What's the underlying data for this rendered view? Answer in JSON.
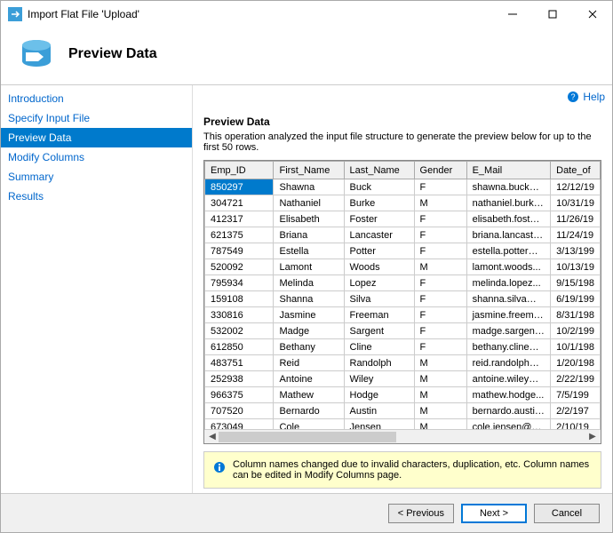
{
  "window": {
    "title": "Import Flat File 'Upload'"
  },
  "header": {
    "title": "Preview Data"
  },
  "help": {
    "label": "Help"
  },
  "sidebar": {
    "items": [
      {
        "label": "Introduction"
      },
      {
        "label": "Specify Input File"
      },
      {
        "label": "Preview Data"
      },
      {
        "label": "Modify Columns"
      },
      {
        "label": "Summary"
      },
      {
        "label": "Results"
      }
    ]
  },
  "main": {
    "title": "Preview Data",
    "desc": "This operation analyzed the input file structure to generate the preview below for up to the first 50 rows.",
    "columns": [
      "Emp_ID",
      "First_Name",
      "Last_Name",
      "Gender",
      "E_Mail",
      "Date_of"
    ],
    "rows": [
      [
        "850297",
        "Shawna",
        "Buck",
        "F",
        "shawna.buck@...",
        "12/12/19"
      ],
      [
        "304721",
        "Nathaniel",
        "Burke",
        "M",
        "nathaniel.burke...",
        "10/31/19"
      ],
      [
        "412317",
        "Elisabeth",
        "Foster",
        "F",
        "elisabeth.foster...",
        "11/26/19"
      ],
      [
        "621375",
        "Briana",
        "Lancaster",
        "F",
        "briana.lancaster...",
        "11/24/19"
      ],
      [
        "787549",
        "Estella",
        "Potter",
        "F",
        "estella.potter@...",
        "3/13/199"
      ],
      [
        "520092",
        "Lamont",
        "Woods",
        "M",
        "lamont.woods...",
        "10/13/19"
      ],
      [
        "795934",
        "Melinda",
        "Lopez",
        "F",
        "melinda.lopez...",
        "9/15/198"
      ],
      [
        "159108",
        "Shanna",
        "Silva",
        "F",
        "shanna.silva@g...",
        "6/19/199"
      ],
      [
        "330816",
        "Jasmine",
        "Freeman",
        "F",
        "jasmine.freema...",
        "8/31/198"
      ],
      [
        "532002",
        "Madge",
        "Sargent",
        "F",
        "madge.sargent...",
        "10/2/199"
      ],
      [
        "612850",
        "Bethany",
        "Cline",
        "F",
        "bethany.cline@...",
        "10/1/198"
      ],
      [
        "483751",
        "Reid",
        "Randolph",
        "M",
        "reid.randolph@...",
        "1/20/198"
      ],
      [
        "252938",
        "Antoine",
        "Wiley",
        "M",
        "antoine.wiley@...",
        "2/22/199"
      ],
      [
        "966375",
        "Mathew",
        "Hodge",
        "M",
        "mathew.hodge...",
        "7/5/199"
      ],
      [
        "707520",
        "Bernardo",
        "Austin",
        "M",
        "bernardo.austin...",
        "2/2/197"
      ],
      [
        "673049",
        "Cole",
        "Jensen",
        "M",
        "cole.jensen@ao...",
        "2/10/19"
      ]
    ],
    "info": "Column names changed due to invalid characters, duplication, etc. Column names can be edited in Modify Columns page."
  },
  "footer": {
    "previous": "< Previous",
    "next": "Next >",
    "cancel": "Cancel"
  }
}
